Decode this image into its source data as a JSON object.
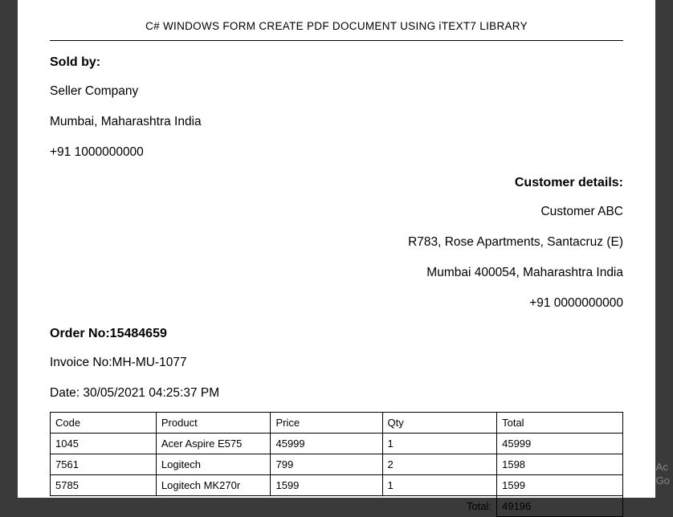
{
  "title": "C# WINDOWS FORM CREATE PDF DOCUMENT USING iTEXT7 LIBRARY",
  "seller": {
    "label": "Sold by:",
    "company": "Seller Company",
    "address": "Mumbai, Maharashtra India",
    "phone": "+91 1000000000"
  },
  "customer": {
    "label": "Customer details:",
    "name": "Customer ABC",
    "address1": "R783, Rose Apartments, Santacruz (E)",
    "address2": "Mumbai 400054, Maharashtra India",
    "phone": "+91 0000000000"
  },
  "order": {
    "order_no_label": "Order No:",
    "order_no": "15484659",
    "invoice_no_label": "Invoice No:",
    "invoice_no": "MH-MU-1077",
    "date_label": "Date: ",
    "date": "30/05/2021 04:25:37 PM"
  },
  "table": {
    "headers": {
      "code": "Code",
      "product": "Product",
      "price": "Price",
      "qty": "Qty",
      "total": "Total"
    },
    "rows": [
      {
        "code": "1045",
        "product": "Acer Aspire E575",
        "price": "45999",
        "qty": "1",
        "total": "45999"
      },
      {
        "code": "7561",
        "product": "Logitech",
        "price": "799",
        "qty": "2",
        "total": "1598"
      },
      {
        "code": "5785",
        "product": "Logitech MK270r",
        "price": "1599",
        "qty": "1",
        "total": "1599"
      }
    ],
    "total_label": "Total:",
    "total_value": "49196"
  },
  "watermark": {
    "line1": "Ac",
    "line2": "Go"
  }
}
